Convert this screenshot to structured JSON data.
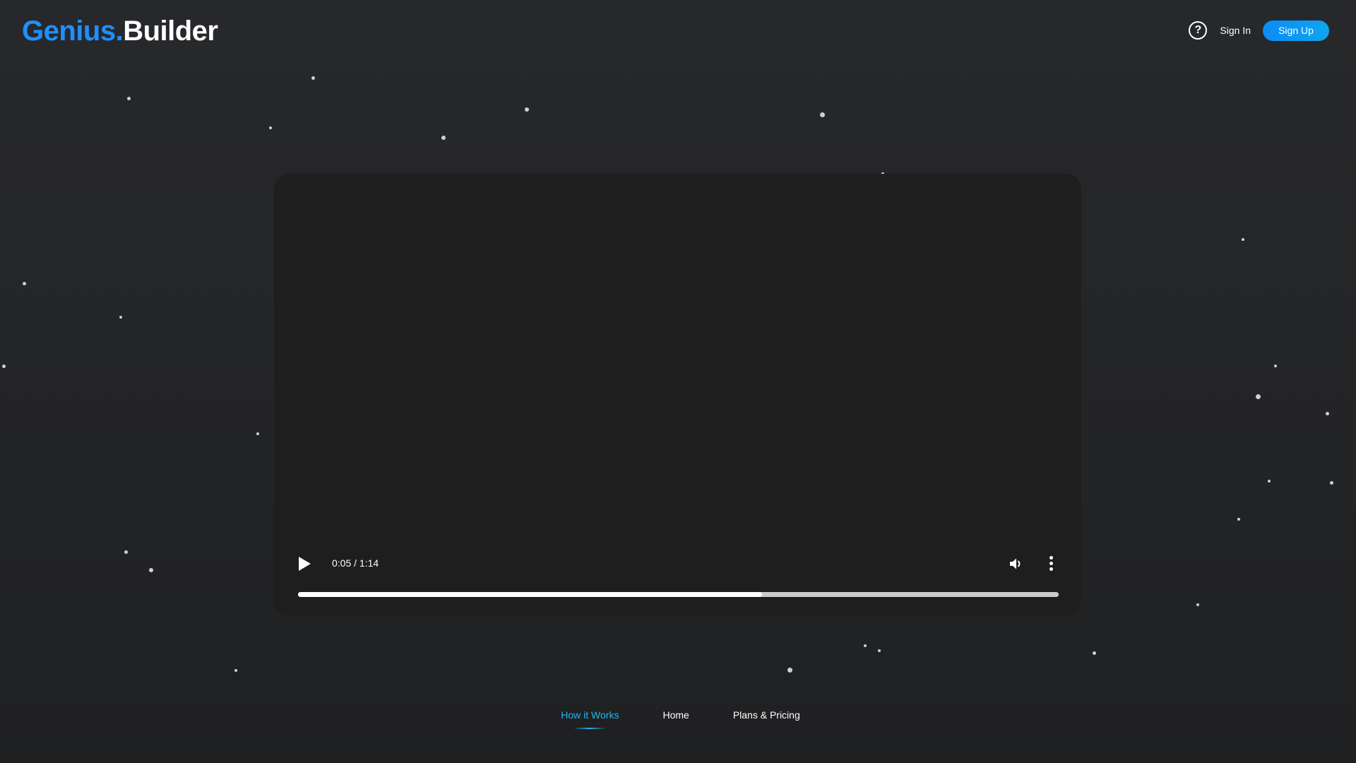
{
  "header": {
    "logo_brand": "Genius.",
    "logo_rest": "Builder",
    "help_icon_glyph": "?",
    "sign_in_label": "Sign In",
    "sign_up_label": "Sign Up"
  },
  "video": {
    "time_display": "0:05 / 1:14",
    "progress_fraction": 0.61
  },
  "bottom_nav": {
    "items": [
      {
        "label": "How it Works",
        "active": true
      },
      {
        "label": "Home",
        "active": false
      },
      {
        "label": "Plans & Pricing",
        "active": false
      }
    ]
  },
  "colors": {
    "brand_blue": "#1f8fff",
    "accent_cyan": "#1fb8f2",
    "sign_up_bg": "#0a8cf5",
    "background": "#252629",
    "video_bg": "#1e1e1f"
  }
}
